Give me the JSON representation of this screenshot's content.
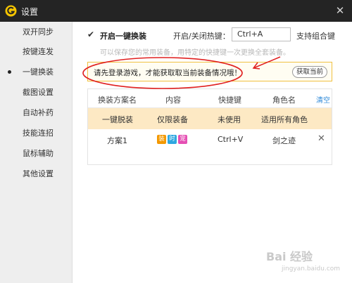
{
  "window": {
    "title": "设置",
    "close_glyph": "✕",
    "logo_icon": "g-logo-icon"
  },
  "sidebar": {
    "items": [
      {
        "label": "双开同步",
        "selected": false
      },
      {
        "label": "按键连发",
        "selected": false
      },
      {
        "label": "一键换装",
        "selected": true
      },
      {
        "label": "截图设置",
        "selected": false
      },
      {
        "label": "自动补药",
        "selected": false
      },
      {
        "label": "技能连招",
        "selected": false
      },
      {
        "label": "鼠标辅助",
        "selected": false
      },
      {
        "label": "其他设置",
        "selected": false
      }
    ]
  },
  "main": {
    "enable_checkbox": {
      "checked": true,
      "glyph": "✔",
      "label": "开启一键换装"
    },
    "hotkey_label": "开启/关闭热键：",
    "hotkey_value": "Ctrl+A",
    "combo_label": "支持组合键",
    "hint": "可以保存您的常用装备，用特定的快捷键一次更换全套装备。",
    "notice": {
      "text": "请先登录游戏，才能获取取当前装备情况哦！",
      "button_label": "获取当前"
    },
    "table": {
      "headers": [
        "换装方案名",
        "内容",
        "快捷键",
        "角色名"
      ],
      "clear_label": "清空",
      "rows": [
        {
          "name": "一键脱装",
          "content": "仅限装备",
          "hotkey": "未使用",
          "role": "适用所有角色"
        },
        {
          "name": "方案1",
          "tags": [
            "装",
            "时",
            "宠"
          ],
          "hotkey": "Ctrl+V",
          "role": "剑之迹",
          "delete_glyph": "✕"
        }
      ]
    }
  },
  "colors": {
    "titlebar": "#242424",
    "logo": "#f5c400",
    "notice_border": "#f0c040",
    "selected_row": "#fde9c4",
    "annotation_red": "#e02020",
    "tag_colors": [
      "#f39800",
      "#2ea7e0",
      "#e54fb4"
    ],
    "link": "#2f8ad8"
  },
  "watermark": {
    "text": "Bai 经验",
    "sub": "jingyan.baidu.com"
  }
}
